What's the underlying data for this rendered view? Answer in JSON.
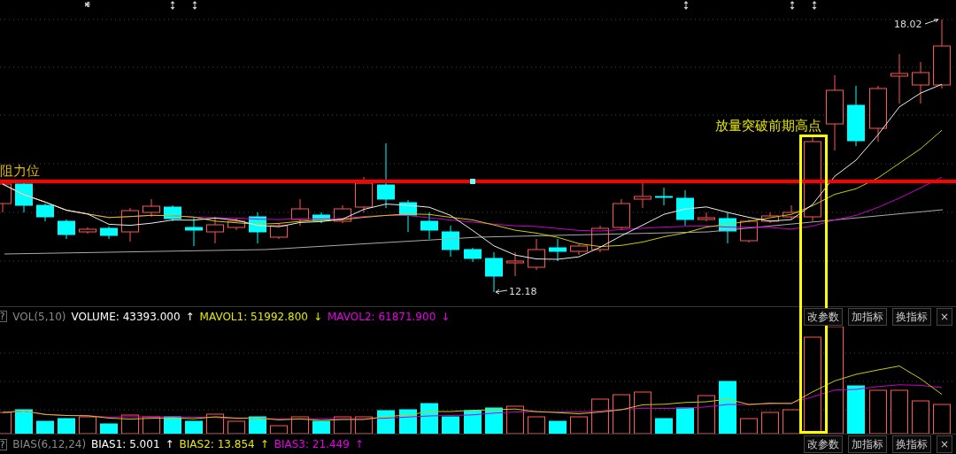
{
  "main_chart": {
    "resistance_label": "阻力位",
    "annotation": "放量突破前期高点",
    "high_label": "18.02",
    "low_label": "12.18"
  },
  "volume_panel": {
    "help": "?",
    "indicator": "VOL(5,10)",
    "values": [
      {
        "label": "VOLUME: 43393.000",
        "arrow": "↑",
        "color": "#ffffff"
      },
      {
        "label": "MAVOL1: 51992.800",
        "arrow": "↓",
        "color": "#e6e600"
      },
      {
        "label": "MAVOL2: 61871.900",
        "arrow": "↓",
        "color": "#e600e6"
      }
    ],
    "buttons": [
      "改参数",
      "加指标",
      "换指标",
      "×"
    ]
  },
  "bias_panel": {
    "help": "?",
    "indicator": "BIAS(6,12,24)",
    "values": [
      {
        "label": "BIAS1: 5.001",
        "arrow": "↑",
        "color": "#ffffff"
      },
      {
        "label": "BIAS2: 13.854",
        "arrow": "↑",
        "color": "#e6e600"
      },
      {
        "label": "BIAS3: 21.449",
        "arrow": "↑",
        "color": "#e600e6"
      }
    ],
    "buttons": [
      "改参数",
      "加指标",
      "换指标",
      "×"
    ]
  }
}
